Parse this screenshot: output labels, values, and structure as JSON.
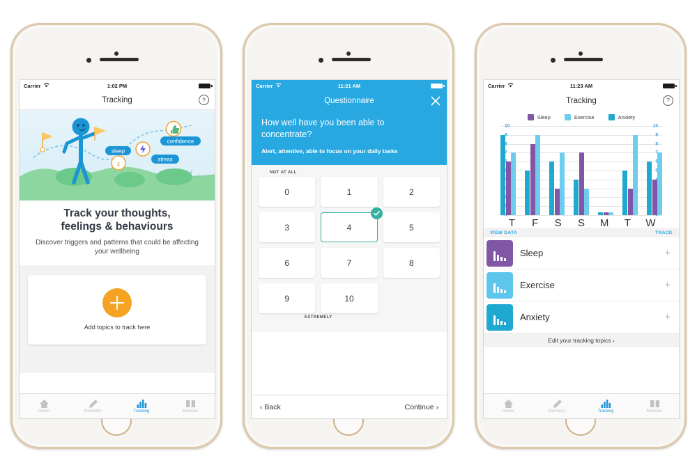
{
  "phones": {
    "one": {
      "status": {
        "carrier": "Carrier",
        "wifi": "wifi-icon",
        "time": "1:02 PM"
      },
      "nav": {
        "title": "Tracking",
        "help": "?"
      },
      "illustration": {
        "labels": [
          "sleep",
          "stress",
          "confidence"
        ],
        "badges": [
          "z-sleep-icon",
          "lightning-icon",
          "thumbs-up-icon"
        ]
      },
      "hero": {
        "title_line1": "Track your thoughts,",
        "title_line2": "feelings & behaviours",
        "subtitle": "Discover triggers and patterns that could be affecting your wellbeing"
      },
      "add_card": {
        "label": "Add topics to track here",
        "button": "plus-icon"
      },
      "tabs": [
        {
          "label": "Home",
          "icon": "home-icon",
          "active": false
        },
        {
          "label": "Moments",
          "icon": "pencil-icon",
          "active": false
        },
        {
          "label": "Tracking",
          "icon": "bar-chart-icon",
          "active": true
        },
        {
          "label": "Modules",
          "icon": "book-icon",
          "active": false
        }
      ]
    },
    "two": {
      "status": {
        "carrier": "Carrier",
        "wifi": "wifi-icon",
        "time": "11:21 AM"
      },
      "nav": {
        "title": "Questionnaire",
        "close": "close-icon"
      },
      "question": "How well have you been able to concentrate?",
      "description": "Alert, attentive, able to focus on your daily tasks",
      "scale": {
        "top_caption": "NOT AT ALL",
        "bottom_caption": "EXTREMELY",
        "options": [
          "0",
          "1",
          "2",
          "3",
          "4",
          "5",
          "6",
          "7",
          "8",
          "9",
          "10"
        ],
        "selected": "4",
        "check": "check-icon"
      },
      "footer": {
        "back": "‹ Back",
        "continue": "Continue ›"
      }
    },
    "three": {
      "status": {
        "carrier": "Carrier",
        "wifi": "wifi-icon",
        "time": "11:23 AM"
      },
      "nav": {
        "title": "Tracking",
        "help": "?"
      },
      "section": {
        "left": "VIEW DATA",
        "right": "TRACK"
      },
      "topics": [
        {
          "label": "Sleep",
          "color": "#8156a5",
          "plus": "plus-icon",
          "icon": "bar-chart-icon"
        },
        {
          "label": "Exercise",
          "color": "#5ec6ea",
          "plus": "plus-icon",
          "icon": "bar-chart-icon"
        },
        {
          "label": "Anxiety",
          "color": "#1fa8d0",
          "plus": "plus-icon",
          "icon": "bar-chart-icon"
        }
      ],
      "edit_link": "Edit your tracking topics ›",
      "tabs": [
        {
          "label": "Home",
          "icon": "home-icon",
          "active": false
        },
        {
          "label": "Moments",
          "icon": "pencil-icon",
          "active": false
        },
        {
          "label": "Tracking",
          "icon": "bar-chart-icon",
          "active": true
        },
        {
          "label": "Modules",
          "icon": "book-icon",
          "active": false
        }
      ]
    }
  },
  "colors": {
    "sleep": "#8156a5",
    "exercise": "#6ecdee",
    "anxiety": "#1fa8d0",
    "accent_blue": "#27a8e0",
    "accent_orange": "#f6a222",
    "accent_teal": "#35b0a0"
  },
  "chart_data": {
    "type": "bar",
    "title": "Tracking",
    "xlabel": "",
    "ylabel": "",
    "ylim": [
      0,
      10
    ],
    "yticks": [
      0,
      1,
      2,
      3,
      4,
      5,
      6,
      7,
      8,
      9,
      10
    ],
    "grid": true,
    "legend_position": "top",
    "categories": [
      "T",
      "F",
      "S",
      "S",
      "M",
      "T",
      "W"
    ],
    "series": [
      {
        "name": "Anxiety",
        "color": "#1fa8d0",
        "values": [
          9,
          5,
          6,
          4,
          0.3,
          5,
          6
        ]
      },
      {
        "name": "Sleep",
        "color": "#8156a5",
        "values": [
          6,
          8,
          3,
          7,
          0.3,
          3,
          4
        ]
      },
      {
        "name": "Exercise",
        "color": "#6ecdee",
        "values": [
          7,
          9,
          7,
          3,
          0.3,
          9,
          7
        ]
      }
    ],
    "series_order_in_group": [
      "Anxiety",
      "Sleep",
      "Exercise"
    ],
    "legend_entries": [
      "Sleep",
      "Exercise",
      "Anxiety"
    ],
    "axis_label_color": "#27a8e0"
  }
}
